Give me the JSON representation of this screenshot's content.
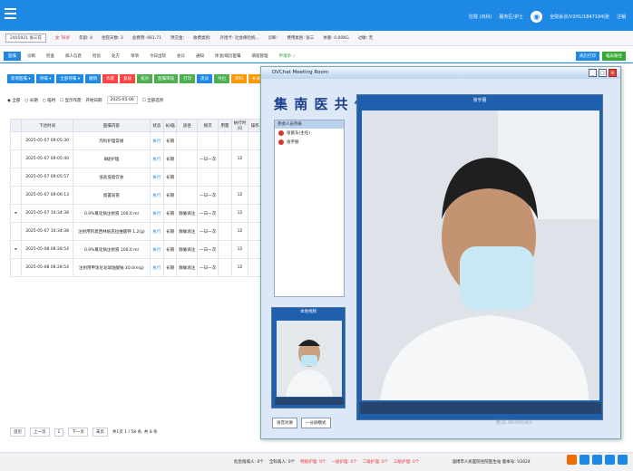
{
  "header": {
    "user_area": "住院 (内科)",
    "dept": "服务区/护士",
    "user": "全院会诊/V2H1/1847194|张",
    "logout": "注销"
  },
  "patient": {
    "bed": "2405921 张三花",
    "gender": "女 76岁",
    "age": "年龄: 4",
    "days": "住院天数: 3",
    "total_fee": "总费用: 661.71",
    "balance": "预交金: ",
    "doctor": "收费类别: ",
    "insurance": "外围卡: 社会保险统...",
    "diag": "诊断: ",
    "fee_type": "费用类别: 张三",
    "weight": "体重: 0.00KG",
    "allergy": "过敏: 无"
  },
  "tabs": [
    "医嘱",
    "诊断",
    "检查",
    "病人信息",
    "检验",
    "处方",
    "单项",
    "今日出院",
    "会诊",
    "通知",
    "体温/病历医嘱",
    "病程管理"
  ],
  "tab_extra": "申请单 ✓",
  "right_buttons": [
    "病历打印",
    "临床路径"
  ],
  "actions": [
    "新增医嘱 ▾",
    "停嘱 ▾",
    "全部停嘱 ▾",
    "撤销",
    "作废",
    "复核",
    "核对",
    "医嘱审核",
    "打印",
    "皮试",
    "导出",
    "转科",
    "补录医嘱",
    "打印处方"
  ],
  "filters": {
    "all": "全部",
    "long": "长期",
    "temp": "临时",
    "show": "显示作废",
    "date_label": "开始日期",
    "date": "2025-05-06",
    "check": "全部选项"
  },
  "table": {
    "headers": [
      "",
      "下达时间",
      "医嘱内容",
      "状态",
      "长/临",
      "途径",
      "频次",
      "用量",
      "执行时间",
      "操作"
    ],
    "rows": [
      [
        "",
        "2025-05-07 09:05:30",
        "内科护理常规",
        "执行",
        "长期",
        "",
        "",
        "",
        "",
        ""
      ],
      [
        "",
        "2025-05-07 09:05:40",
        "Ⅲ级护理",
        "执行",
        "长期",
        "",
        "一日一次",
        "",
        "12",
        ""
      ],
      [
        "",
        "2025-05-07 09:05:57",
        "低盐低脂饮食",
        "执行",
        "长期",
        "",
        "",
        "",
        "",
        ""
      ],
      [
        "",
        "2025-05-07 09:06:13",
        "留置尿管",
        "执行",
        "长期",
        "",
        "一日一次",
        "",
        "12",
        ""
      ],
      [
        "▸",
        "2025-05-07 10:34:38",
        "0.9%氯化钠注射液 100.0 ml",
        "执行",
        "长期",
        "静脉滴注",
        "一日一次",
        "",
        "12",
        ""
      ],
      [
        "",
        "2025-05-07 10:34:38",
        "注射用阿莫西林钠克拉维酸钾 1.2(g)",
        "执行",
        "长期",
        "静脉滴注",
        "一日一次",
        "",
        "12",
        ""
      ],
      [
        "▸",
        "2025-05-08 08:28:54",
        "0.9%氯化钠注射液 100.0 ml",
        "执行",
        "长期",
        "静脉滴注",
        "一日一次",
        "",
        "12",
        ""
      ],
      [
        "",
        "2025-05-08 08:28:54",
        "注射用甲泼尼龙琥珀酸钠 20.0(mg)",
        "执行",
        "长期",
        "静脉滴注",
        "一日一次",
        "",
        "12",
        ""
      ]
    ]
  },
  "pager": {
    "first": "首页",
    "prev": "上一页",
    "page": "1",
    "next": "下一页",
    "last": "末页",
    "info": "共1页 1 / 58 条, 共 8 条"
  },
  "status": {
    "items": [
      "危急值病人: 0个",
      "全科病人: 0个",
      "特级护理: 0个",
      "一级护理: 0个",
      "二级护理: 0个",
      "三级护理: 0个"
    ],
    "hospital": "淄博市人民医院住院医生站 版本号: V2024"
  },
  "meeting": {
    "title": "DVChat Meeting Room",
    "logo": "集 南 医 共 体",
    "list_header": "参会人员列表",
    "users": [
      "张富东(主任)",
      "张宇朋"
    ],
    "big_caption": "张宇朋",
    "small_caption": "本地视频",
    "mode": "语音对讲",
    "layout": "一分屏模式"
  },
  "watermark": "激活 Windows"
}
